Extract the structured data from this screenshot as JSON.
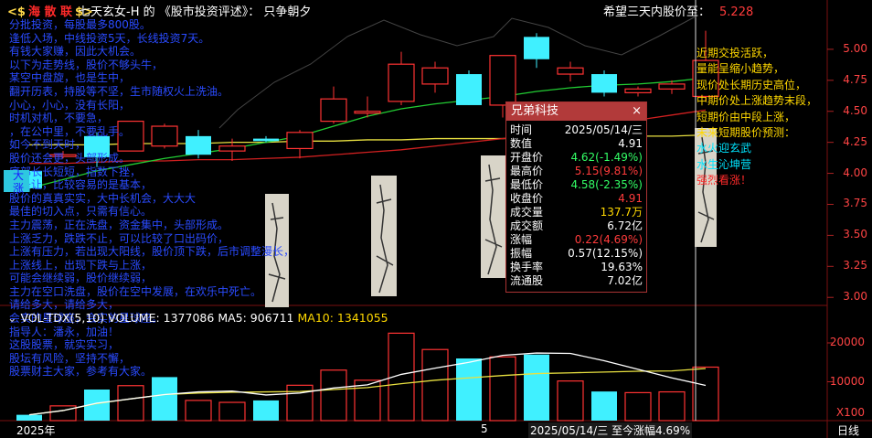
{
  "header": {
    "brand_tag": "<$",
    "brand_name": "海 散 联",
    "brand_end": "$>",
    "title": "七天玄女-H  的 《股市投资评述》： 只争朝夕",
    "hope_label": "希望三天内股价至：",
    "hope_value": "5.228"
  },
  "overlay_lines": [
    "分批投资，每股最多800股。",
    "逢低入场，中线投资5天，长线投资7天。",
    "有钱大家赚，因此大机会。",
    "以下为走势线，股价不够头牛，",
    "某空中盘旋，也是生中，",
    "翻开历表，持股等不坚，生市随权火上洗油。",
    "小心，小心，没有长阳，",
    "时机对机，不要急，",
    "，在公中里，不要乱手。",
    "如今不到天时，",
    "股价还会更，头部形成。",
    "底部长长短短，指数下挫，",
    "都是让，比较容易的是基本，",
    "股价的真真实实，大中长机会，大大大",
    "最佳的切入点，只需有信心。",
    "主力震荡，正在洗盘，资金集中，头部形成。",
    "上涨乏力，跌跌不止，可以比较了口出码价，",
    "上涨有压力，若出现大阳线，股价顶下跌，后市调整漫长，",
    "上涨线上，出现下跌与上涨，",
    "可能会继续弱，股价继续弱，",
    "主力在空口洗盘，股价在空中发展，在欢乐中死亡。",
    "请给多大，请给多大，",
    "会实的星球座，会实的星球座。",
    "指导人：潘永，加油！",
    "这股股票，就实实习，",
    "股坛有风险，坚持不懈，",
    "股票财主大家，参考有大家。"
  ],
  "right_notes": [
    {
      "text": "近期交投活跃，",
      "color": "yellow"
    },
    {
      "text": "量能呈缩小趋势，",
      "color": "yellow"
    },
    {
      "text": "现价处长期历史高位，",
      "color": "yellow"
    },
    {
      "text": "中期价处上涨趋势末段，",
      "color": "yellow"
    },
    {
      "text": "短期价由中段上涨，",
      "color": "yellow"
    },
    {
      "text": "未来短期股价预测：",
      "color": "yellow"
    },
    {
      "text": "水火迎玄武",
      "color": "cyan"
    },
    {
      "text": "水生沁坤营",
      "color": "cyan"
    },
    {
      "text": "强烈看涨！",
      "color": "red"
    }
  ],
  "popup": {
    "title": "兄弟科技",
    "close": "×",
    "rows": [
      {
        "k": "时间",
        "v": "2025/05/14/三",
        "c": "white"
      },
      {
        "k": "数值",
        "v": "4.91",
        "c": "white"
      },
      {
        "k": "开盘价",
        "v": "4.62(-1.49%)",
        "c": "green"
      },
      {
        "k": "最高价",
        "v": "5.15(9.81%)",
        "c": "red"
      },
      {
        "k": "最低价",
        "v": "4.58(-2.35%)",
        "c": "green"
      },
      {
        "k": "收盘价",
        "v": "4.91",
        "c": "red"
      },
      {
        "k": "成交量",
        "v": "137.7万",
        "c": "yellow"
      },
      {
        "k": "成交额",
        "v": "6.72亿",
        "c": "white"
      },
      {
        "k": "涨幅",
        "v": "0.22(4.69%)",
        "c": "red"
      },
      {
        "k": "振幅",
        "v": "0.57(12.15%)",
        "c": "white"
      },
      {
        "k": "换手率",
        "v": "19.63%",
        "c": "white"
      },
      {
        "k": "流通股",
        "v": "7.02亿",
        "c": "white"
      }
    ]
  },
  "volume_header": {
    "name": "VOL-TDX(5,10)",
    "volume": "VOLUME: 1377086",
    "ma5": "MA5: 906711",
    "ma10": "MA10: 1341055"
  },
  "bottom": {
    "year": "2025年",
    "month": "5",
    "cursor": "2025/05/14/三  至今涨幅4.69%",
    "period": "日线"
  },
  "price_axis": [
    "5.00",
    "4.75",
    "4.50",
    "4.25",
    "4.00",
    "3.75",
    "3.50",
    "3.25",
    "3.00"
  ],
  "volume_axis": [
    "20000",
    "10000",
    "X100"
  ],
  "small_labels": {
    "left1": "大",
    "left2": "涨"
  },
  "chart_data": {
    "type": "candlestick",
    "price_ylim": [
      2.95,
      5.25
    ],
    "price_ticks": [
      3.0,
      3.25,
      3.5,
      3.75,
      4.0,
      4.25,
      4.5,
      4.75,
      5.0
    ],
    "candles": [
      {
        "o": 3.88,
        "c": 4.02,
        "h": 4.02,
        "l": 3.85,
        "up": false
      },
      {
        "o": 4.15,
        "c": 4.15,
        "h": 4.18,
        "l": 4.12,
        "up": true
      },
      {
        "o": 4.13,
        "c": 4.3,
        "h": 4.33,
        "l": 4.05,
        "up": false
      },
      {
        "o": 4.42,
        "c": 4.18,
        "h": 4.42,
        "l": 4.18,
        "up": true
      },
      {
        "o": 4.22,
        "c": 4.38,
        "h": 4.4,
        "l": 4.2,
        "up": true
      },
      {
        "o": 4.3,
        "c": 4.15,
        "h": 4.35,
        "l": 4.12,
        "up": false
      },
      {
        "o": 4.18,
        "c": 4.22,
        "h": 4.28,
        "l": 4.1,
        "up": true
      },
      {
        "o": 4.28,
        "c": 4.26,
        "h": 4.3,
        "l": 4.25,
        "up": false
      },
      {
        "o": 4.2,
        "c": 4.33,
        "h": 4.35,
        "l": 4.12,
        "up": true
      },
      {
        "o": 4.42,
        "c": 4.6,
        "h": 4.7,
        "l": 4.4,
        "up": true
      },
      {
        "o": 4.5,
        "c": 4.5,
        "h": 4.62,
        "l": 4.45,
        "up": true
      },
      {
        "o": 4.58,
        "c": 4.88,
        "h": 4.98,
        "l": 4.55,
        "up": true
      },
      {
        "o": 4.72,
        "c": 4.85,
        "h": 4.9,
        "l": 4.65,
        "up": true
      },
      {
        "o": 4.8,
        "c": 4.55,
        "h": 4.83,
        "l": 4.55,
        "up": false
      },
      {
        "o": 4.55,
        "c": 4.95,
        "h": 4.95,
        "l": 4.45,
        "up": true
      },
      {
        "o": 5.1,
        "c": 4.92,
        "h": 5.13,
        "l": 4.85,
        "up": false
      },
      {
        "o": 4.85,
        "c": 4.8,
        "h": 4.9,
        "l": 4.74,
        "up": true
      },
      {
        "o": 4.8,
        "c": 4.65,
        "h": 4.83,
        "l": 4.62,
        "up": false
      },
      {
        "o": 4.65,
        "c": 4.68,
        "h": 4.7,
        "l": 4.62,
        "up": true
      },
      {
        "o": 4.68,
        "c": 4.72,
        "h": 4.75,
        "l": 4.64,
        "up": true
      },
      {
        "o": 4.62,
        "c": 4.91,
        "h": 5.15,
        "l": 4.58,
        "up": true
      }
    ],
    "ma_long": [
      3.88,
      3.95,
      4.02,
      4.07,
      4.12,
      4.16,
      4.2,
      4.25,
      4.3,
      4.38,
      4.46,
      4.52,
      4.56,
      4.59,
      4.62,
      4.66,
      4.69,
      4.71,
      4.72,
      4.74,
      4.77
    ],
    "ma_mid": [
      4.08,
      4.08,
      4.09,
      4.1,
      4.1,
      4.11,
      4.11,
      4.12,
      4.13,
      4.15,
      4.17,
      4.19,
      4.22,
      4.25,
      4.28,
      4.31,
      4.35,
      4.39,
      4.43,
      4.47,
      4.51
    ],
    "ma_flat": [
      4.23,
      4.23,
      4.23,
      4.24,
      4.24,
      4.24,
      4.25,
      4.25,
      4.26,
      4.26,
      4.27,
      4.27,
      4.28,
      4.28,
      4.28,
      4.29,
      4.29,
      4.3,
      4.3,
      4.3,
      4.31
    ],
    "volumes": [
      1500,
      3800,
      8000,
      9000,
      11200,
      5200,
      4700,
      5200,
      9100,
      13000,
      10400,
      22500,
      18300,
      16000,
      16400,
      17000,
      10200,
      7500,
      7200,
      7400,
      13770
    ],
    "vol_up": [
      false,
      true,
      false,
      true,
      false,
      true,
      true,
      false,
      true,
      true,
      true,
      true,
      true,
      false,
      true,
      false,
      true,
      false,
      true,
      true,
      true
    ],
    "vol_ma5": [
      1500,
      2600,
      4500,
      5600,
      6700,
      7400,
      7600,
      6600,
      7100,
      8400,
      9200,
      11900,
      13500,
      15000,
      16800,
      17400,
      17300,
      15400,
      13200,
      11000,
      9067
    ],
    "vol_ma10": [
      1500,
      2600,
      4400,
      5600,
      6700,
      7100,
      7300,
      7400,
      7500,
      8000,
      8500,
      9500,
      10400,
      11000,
      11600,
      12100,
      12300,
      12500,
      12700,
      12800,
      13410
    ],
    "vol_ylim": [
      0,
      24000
    ]
  }
}
